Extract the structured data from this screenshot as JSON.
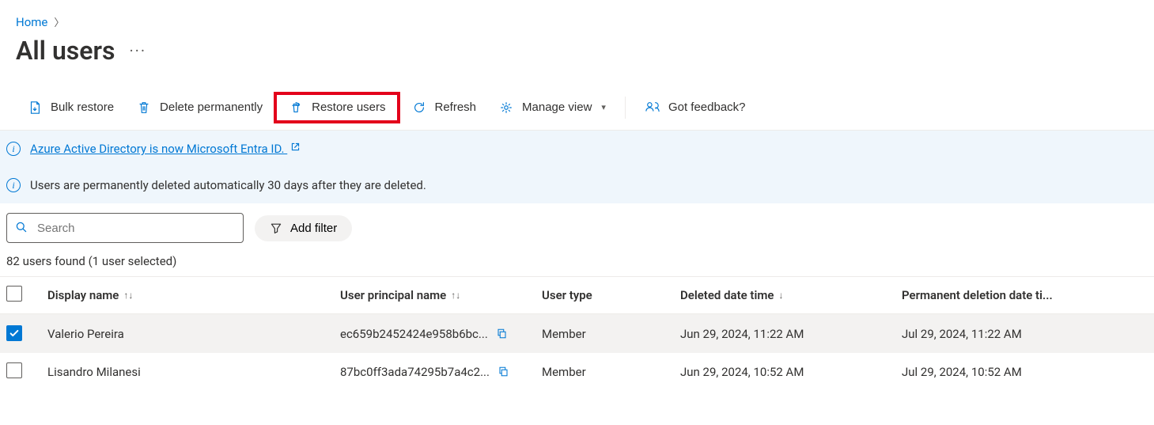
{
  "breadcrumb": {
    "home": "Home"
  },
  "page": {
    "title": "All users"
  },
  "toolbar": {
    "bulk_restore": "Bulk restore",
    "delete_permanently": "Delete permanently",
    "restore_users": "Restore users",
    "refresh": "Refresh",
    "manage_view": "Manage view",
    "got_feedback": "Got feedback?"
  },
  "info": {
    "entra_link": "Azure Active Directory is now Microsoft Entra ID.",
    "retention": "Users are permanently deleted automatically 30 days after they are deleted."
  },
  "search": {
    "placeholder": "Search"
  },
  "filter": {
    "add": "Add filter"
  },
  "status": {
    "text": "82 users found (1 user selected)"
  },
  "columns": {
    "display_name": "Display name",
    "upn": "User principal name",
    "user_type": "User type",
    "deleted": "Deleted date time",
    "perm_del": "Permanent deletion date ti..."
  },
  "rows": [
    {
      "selected": true,
      "display_name": "Valerio Pereira",
      "upn": "ec659b2452424e958b6bc...",
      "user_type": "Member",
      "deleted": "Jun 29, 2024, 11:22 AM",
      "perm_del": "Jul 29, 2024, 11:22 AM"
    },
    {
      "selected": false,
      "display_name": "Lisandro Milanesi",
      "upn": "87bc0ff3ada74295b7a4c2...",
      "user_type": "Member",
      "deleted": "Jun 29, 2024, 10:52 AM",
      "perm_del": "Jul 29, 2024, 10:52 AM"
    }
  ]
}
